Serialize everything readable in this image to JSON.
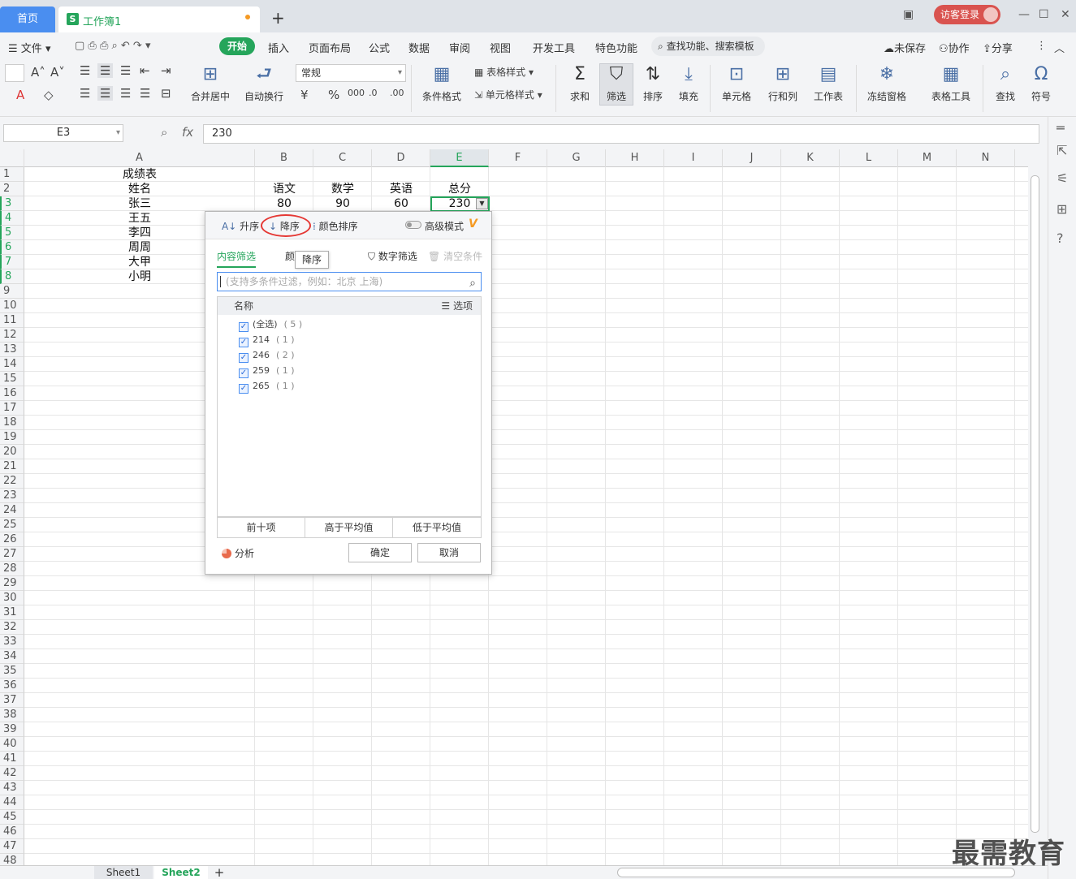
{
  "title_bar": {
    "home_tab": "首页",
    "doc_tab": "工作簿1",
    "doc_icon": "S",
    "add_tab": "+",
    "login": "访客登录"
  },
  "menu": {
    "file": "文件",
    "start": "开始",
    "items": [
      "插入",
      "页面布局",
      "公式",
      "数据",
      "审阅",
      "视图",
      "开发工具",
      "特色功能"
    ],
    "search": "查找功能、搜索模板",
    "unsaved": "未保存",
    "collab": "协作",
    "share": "分享"
  },
  "ribbon": {
    "merge": "合并居中",
    "wrap": "自动换行",
    "number_format": "常规",
    "cond_format": "条件格式",
    "table_style": "表格样式",
    "cell_style": "单元格样式",
    "sum": "求和",
    "filter": "筛选",
    "sort": "排序",
    "fill": "填充",
    "cell": "单元格",
    "rowcol": "行和列",
    "sheet": "工作表",
    "freeze": "冻结窗格",
    "table_tools": "表格工具",
    "find": "查找",
    "symbol": "符号"
  },
  "formula_bar": {
    "name_box": "E3",
    "fx": "fx",
    "value": "230"
  },
  "columns": [
    "A",
    "B",
    "C",
    "D",
    "E",
    "F",
    "G",
    "H",
    "I",
    "J",
    "K",
    "L",
    "M",
    "N"
  ],
  "rows": [
    "1",
    "2",
    "3",
    "4",
    "5",
    "6",
    "7",
    "8",
    "9",
    "10",
    "11",
    "12",
    "13",
    "14",
    "15",
    "16",
    "17",
    "18",
    "19",
    "20",
    "21",
    "22",
    "23",
    "24",
    "25",
    "26",
    "27",
    "28",
    "29",
    "30",
    "31",
    "32",
    "33",
    "34",
    "35",
    "36",
    "37",
    "38",
    "39",
    "40",
    "41",
    "42",
    "43",
    "44",
    "45",
    "46",
    "47",
    "48"
  ],
  "cells": {
    "A1": "成绩表",
    "A2": "姓名",
    "B2": "语文",
    "C2": "数学",
    "D2": "英语",
    "E2": "总分",
    "A3": "张三",
    "B3": "80",
    "C3": "90",
    "D3": "60",
    "E3": "230",
    "A4": "王五",
    "A5": "李四",
    "A6": "周周",
    "A7": "大甲",
    "A8": "小明"
  },
  "filter_dialog": {
    "asc": "升序",
    "desc": "降序",
    "color_sort": "颜色排序",
    "advanced": "高级模式",
    "tab_content": "内容筛选",
    "tab_color": "颜",
    "tooltip": "降序",
    "number_filter": "数字筛选",
    "clear": "清空条件",
    "search_placeholder": "(支持多条件过滤，例如：北京  上海)",
    "list_header": "名称",
    "options": "选项",
    "items": [
      {
        "label": "(全选)",
        "count": "( 5 )"
      },
      {
        "label": "214",
        "count": "( 1 )"
      },
      {
        "label": "246",
        "count": "( 2 )"
      },
      {
        "label": "259",
        "count": "( 1 )"
      },
      {
        "label": "265",
        "count": "( 1 )"
      }
    ],
    "top10": "前十项",
    "above_avg": "高于平均值",
    "below_avg": "低于平均值",
    "analysis": "分析",
    "ok": "确定",
    "cancel": "取消"
  },
  "sheets": [
    "Sheet1",
    "Sheet2"
  ],
  "active_sheet": "Sheet2",
  "watermark": "最需教育",
  "accent_color": "#25a55b"
}
